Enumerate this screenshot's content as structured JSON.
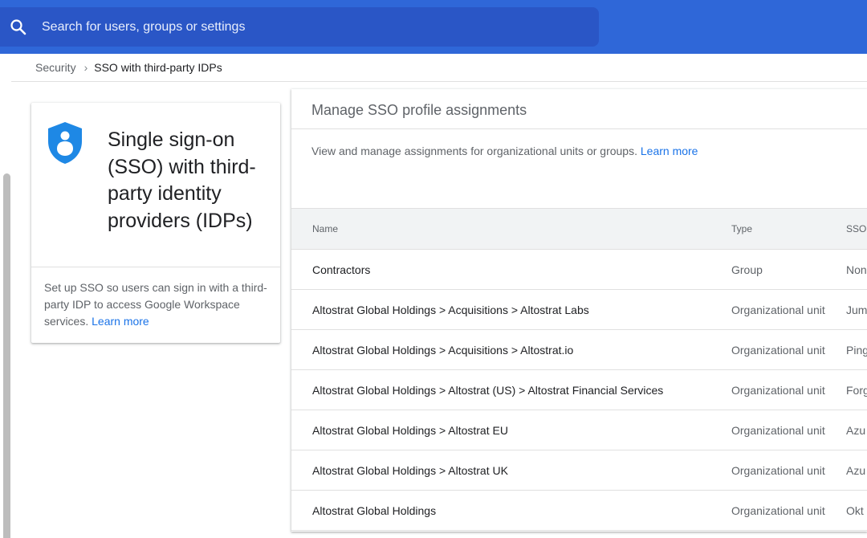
{
  "search": {
    "placeholder": "Search for users, groups or settings"
  },
  "breadcrumb": {
    "parent": "Security",
    "separator": "›",
    "current": "SSO with third-party IDPs"
  },
  "info_card": {
    "title": "Single sign-on (SSO) with third-party identity providers (IDPs)",
    "description": "Set up SSO so users can sign in with a third-party IDP to access Google Workspace services.",
    "learn_more": "Learn more",
    "icon": "shield-person-icon",
    "icon_color": "#1e88e5"
  },
  "main": {
    "title": "Manage SSO profile assignments",
    "subtitle": "View and manage assignments for organizational units or groups.",
    "learn_more": "Learn more",
    "table": {
      "headers": {
        "name": "Name",
        "type": "Type",
        "sso": "SSO"
      },
      "rows": [
        {
          "name": "Contractors",
          "type": "Group",
          "sso": "Non"
        },
        {
          "name": "Altostrat Global Holdings > Acquisitions > Altostrat Labs",
          "type": "Organizational unit",
          "sso": "Jum"
        },
        {
          "name": "Altostrat Global Holdings > Acquisitions > Altostrat.io",
          "type": "Organizational unit",
          "sso": "Ping"
        },
        {
          "name": "Altostrat Global Holdings > Altostrat (US) > Altostrat Financial Services",
          "type": "Organizational unit",
          "sso": "Forg"
        },
        {
          "name": "Altostrat Global Holdings > Altostrat EU",
          "type": "Organizational unit",
          "sso": "Azu"
        },
        {
          "name": "Altostrat Global Holdings > Altostrat UK",
          "type": "Organizational unit",
          "sso": "Azu"
        },
        {
          "name": "Altostrat Global Holdings",
          "type": "Organizational unit",
          "sso": "Okt"
        }
      ]
    }
  },
  "colors": {
    "topbar": "#2f67d8",
    "search_bg": "#2a56c6",
    "link": "#1a73e8"
  }
}
